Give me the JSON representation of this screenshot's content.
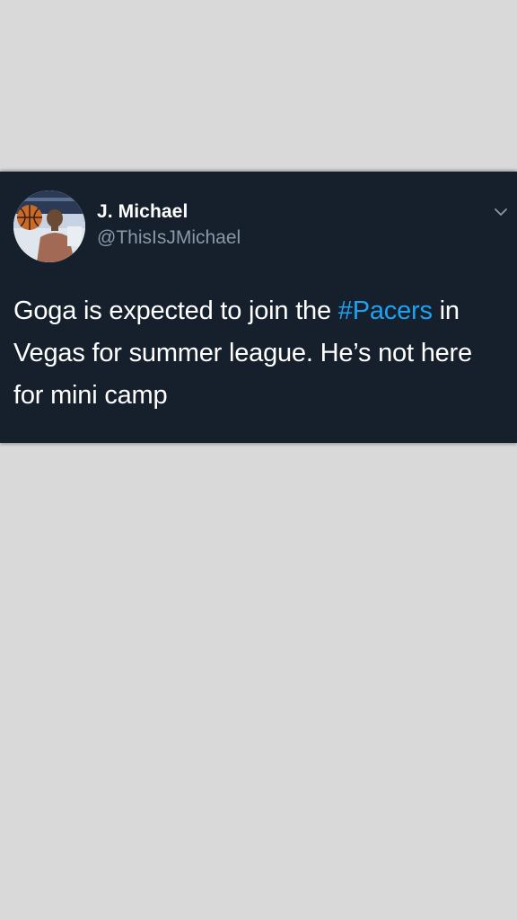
{
  "tweet": {
    "display_name": "J. Michael",
    "handle": "@ThisIsJMichael",
    "text_before": "Goga is expected to join the ",
    "hashtag": "#Pacers",
    "text_after": " in Vegas for summer league. He’s not here  for mini camp",
    "accent_color": "#1da1f2",
    "background_color": "#16202c",
    "avatar_icon": "profile-photo",
    "menu_icon": "chevron-down-icon"
  }
}
